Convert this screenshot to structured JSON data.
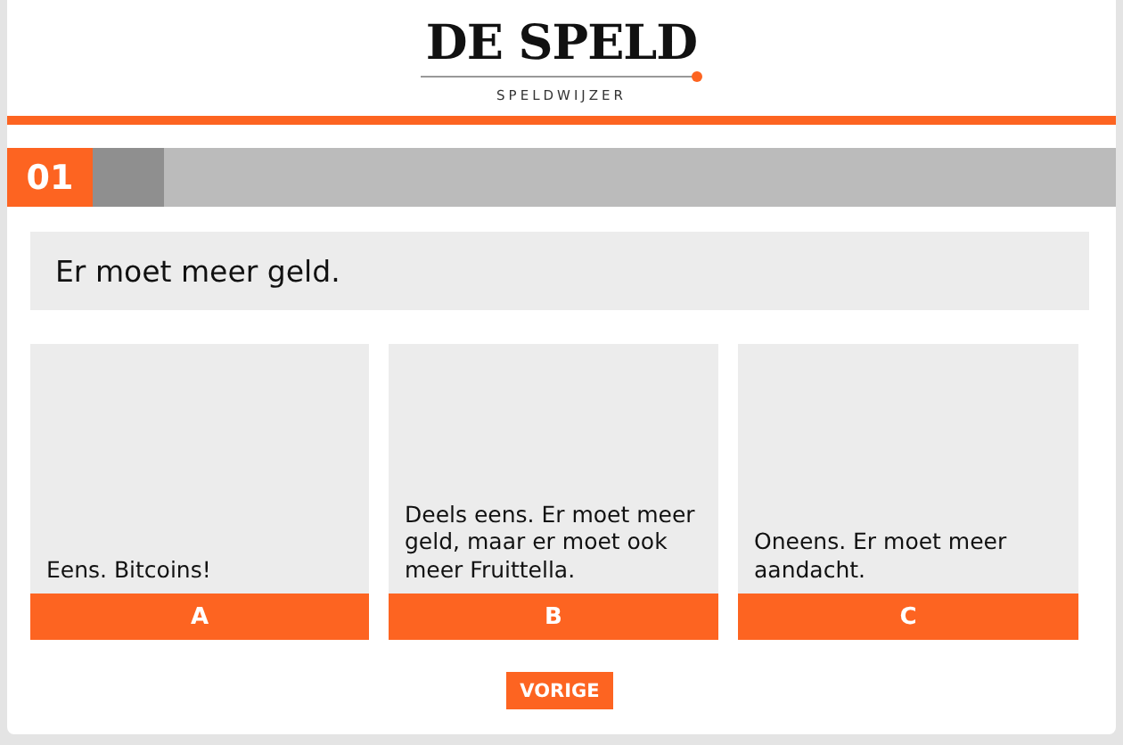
{
  "logo": {
    "title": "DE SPELD",
    "subtitle": "SPELDWIJZER"
  },
  "progress": {
    "number": "01",
    "level": 0.07
  },
  "question": "Er moet meer geld.",
  "answers": [
    {
      "text": "Eens. Bitcoins!",
      "letter": "A"
    },
    {
      "text": "Deels eens. Er moet meer geld, maar er moet ook meer Fruittella.",
      "letter": "B"
    },
    {
      "text": "Oneens. Er moet meer aandacht.",
      "letter": "C"
    }
  ],
  "back_button": "VORIGE"
}
